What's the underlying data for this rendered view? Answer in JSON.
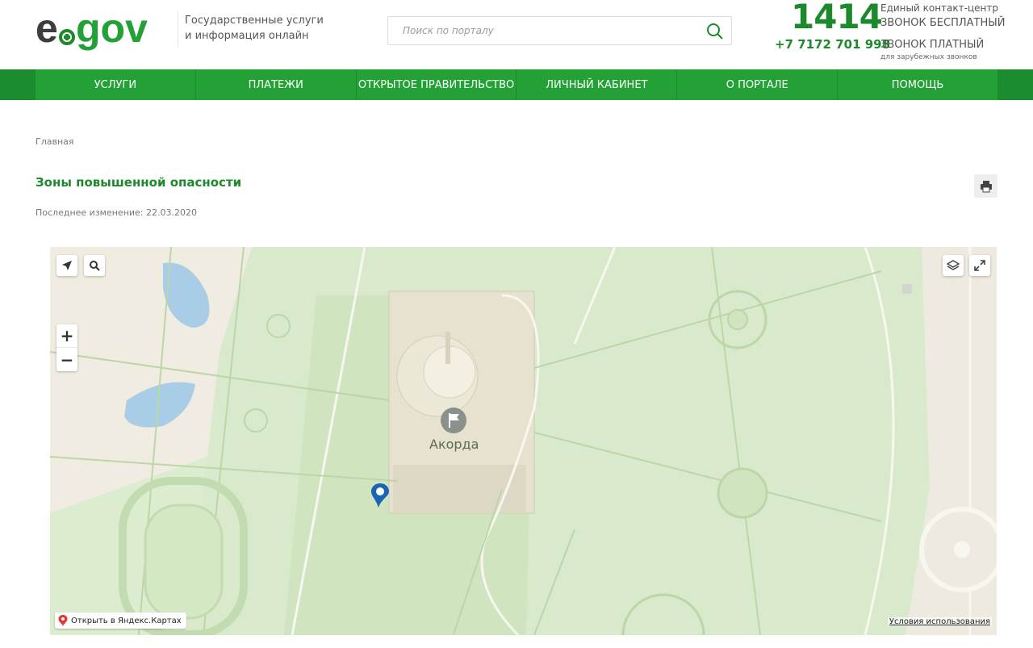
{
  "header": {
    "logo_alt": "egov",
    "tagline_line1": "Государственные услуги",
    "tagline_line2": "и информация онлайн",
    "search_placeholder": "Поиск по порталу",
    "phone_main": "1414",
    "phone_main_label1": "Единый контакт-центр",
    "phone_main_label2": "ЗВОНОК БЕСПЛАТНЫЙ",
    "phone_alt": "+7 7172 701 998",
    "phone_alt_label1": "ЗВОНОК ПЛАТНЫЙ",
    "phone_alt_label2": "для зарубежных звонков"
  },
  "nav": {
    "items": [
      {
        "label": "УСЛУГИ"
      },
      {
        "label": "ПЛАТЕЖИ"
      },
      {
        "label": "ОТКРЫТОЕ ПРАВИТЕЛЬСТВО"
      },
      {
        "label": "ЛИЧНЫЙ КАБИНЕТ"
      },
      {
        "label": "О ПОРТАЛЕ"
      },
      {
        "label": "ПОМОЩЬ"
      }
    ]
  },
  "content": {
    "breadcrumb": "Главная",
    "title": "Зоны повышенной опасности",
    "updated": "Последнее изменение: 22.03.2020"
  },
  "map": {
    "place_label": "Акорда",
    "open_link": "Открыть в Яндекс.Картах",
    "terms_link": "Условия использования",
    "zoom_in": "+",
    "zoom_out": "−"
  },
  "colors": {
    "brand_green": "#1c8a2c",
    "nav_green": "#23a036",
    "map_green": "#d6e8c8"
  },
  "icons": [
    "search-icon",
    "print-icon",
    "locate-icon",
    "map-search-icon",
    "layers-icon",
    "fullscreen-icon",
    "map-pin-icon",
    "flag-icon"
  ]
}
